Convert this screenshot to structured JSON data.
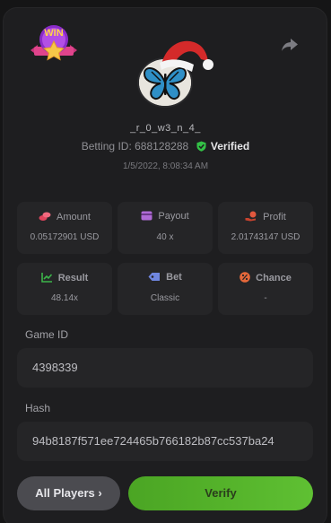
{
  "profile": {
    "badge_text": "WIN",
    "username": "_r_0_w3_n_4_",
    "betting_id_label": "Betting ID:",
    "betting_id": "688128288",
    "verified_label": "Verified",
    "date": "1/5/2022, 8:08:34 AM"
  },
  "stats": {
    "amount": {
      "label": "Amount",
      "value": "0.05172901 USD",
      "icon": "coins-icon"
    },
    "payout": {
      "label": "Payout",
      "value": "40 x",
      "icon": "wallet-icon"
    },
    "profit": {
      "label": "Profit",
      "value": "2.01743147 USD",
      "icon": "hand-coin-icon"
    },
    "result": {
      "label": "Result",
      "value": "48.14x",
      "icon": "chart-up-icon"
    },
    "bet": {
      "label": "Bet",
      "value": "Classic",
      "icon": "tag-icon"
    },
    "chance": {
      "label": "Chance",
      "value": "-",
      "icon": "percent-icon"
    }
  },
  "game": {
    "game_id_label": "Game ID",
    "game_id": "4398339",
    "hash_label": "Hash",
    "hash": "94b8187f571ee724465b766182b87cc537ba24"
  },
  "actions": {
    "all_players": "All Players",
    "all_players_chevron": "›",
    "verify": "Verify"
  },
  "colors": {
    "background": "#151516",
    "panel": "#1e1e20",
    "card": "#252527",
    "verified_shield": "#33c146",
    "verify_button": "#54b22a",
    "all_players_button": "#4b4b50"
  }
}
